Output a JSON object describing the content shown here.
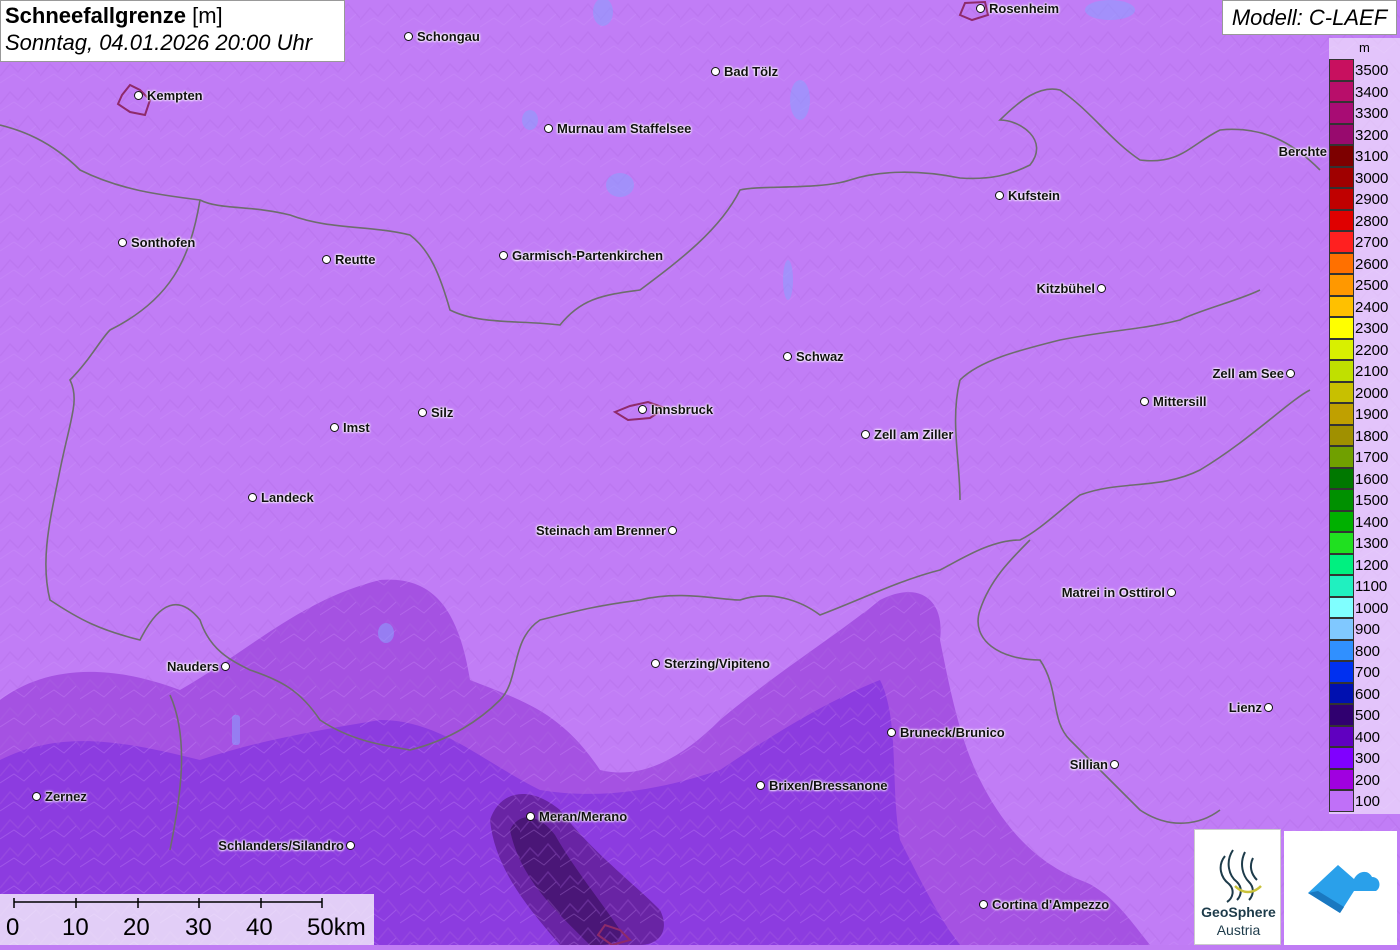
{
  "title": {
    "variable": "Schneefallgrenze",
    "unit": "[m]",
    "datetime": "Sonntag, 04.01.2026 20:00 Uhr"
  },
  "model_label": "Modell: C-LAEF",
  "legend": {
    "unit": "m",
    "levels": [
      {
        "value": "3500",
        "color": "#c8105f"
      },
      {
        "value": "3400",
        "color": "#b80e6a"
      },
      {
        "value": "3300",
        "color": "#a80c74"
      },
      {
        "value": "3200",
        "color": "#980a6e"
      },
      {
        "value": "3100",
        "color": "#7d0000"
      },
      {
        "value": "3000",
        "color": "#a00000"
      },
      {
        "value": "2900",
        "color": "#c00000"
      },
      {
        "value": "2800",
        "color": "#e00000"
      },
      {
        "value": "2700",
        "color": "#ff2020"
      },
      {
        "value": "2600",
        "color": "#ff7000"
      },
      {
        "value": "2500",
        "color": "#ff9800"
      },
      {
        "value": "2400",
        "color": "#ffc000"
      },
      {
        "value": "2300",
        "color": "#ffff00"
      },
      {
        "value": "2200",
        "color": "#d8f000"
      },
      {
        "value": "2100",
        "color": "#c0e000"
      },
      {
        "value": "2000",
        "color": "#c8c000"
      },
      {
        "value": "1900",
        "color": "#c0a000"
      },
      {
        "value": "1800",
        "color": "#a09000"
      },
      {
        "value": "1700",
        "color": "#70a000"
      },
      {
        "value": "1600",
        "color": "#007800"
      },
      {
        "value": "1500",
        "color": "#009000"
      },
      {
        "value": "1400",
        "color": "#00b000"
      },
      {
        "value": "1300",
        "color": "#20e020"
      },
      {
        "value": "1200",
        "color": "#00f080"
      },
      {
        "value": "1100",
        "color": "#20f0c0"
      },
      {
        "value": "1000",
        "color": "#80ffff"
      },
      {
        "value": "900",
        "color": "#80c8ff"
      },
      {
        "value": "800",
        "color": "#3090ff"
      },
      {
        "value": "700",
        "color": "#0030f0"
      },
      {
        "value": "600",
        "color": "#0010b0"
      },
      {
        "value": "500",
        "color": "#300070"
      },
      {
        "value": "400",
        "color": "#6000c0"
      },
      {
        "value": "300",
        "color": "#8000ff"
      },
      {
        "value": "200",
        "color": "#a000e0"
      },
      {
        "value": "100",
        "color": "#c070f8"
      }
    ]
  },
  "cities": [
    {
      "name": "Schongau",
      "label_side": "right"
    },
    {
      "name": "Rosenheim",
      "label_side": "right"
    },
    {
      "name": "Kempten",
      "label_side": "right"
    },
    {
      "name": "Bad Tölz",
      "label_side": "right"
    },
    {
      "name": "Murnau am Staffelsee",
      "label_side": "right"
    },
    {
      "name": "Kufstein",
      "label_side": "right"
    },
    {
      "name": "Sonthofen",
      "label_side": "right"
    },
    {
      "name": "Reutte",
      "label_side": "right"
    },
    {
      "name": "Garmisch-Partenkirchen",
      "label_side": "right"
    },
    {
      "name": "Kitzbühel",
      "label_side": "left"
    },
    {
      "name": "Schwaz",
      "label_side": "right"
    },
    {
      "name": "Zell am See",
      "label_side": "left"
    },
    {
      "name": "Mittersill",
      "label_side": "right"
    },
    {
      "name": "Silz",
      "label_side": "right"
    },
    {
      "name": "Innsbruck",
      "label_side": "right"
    },
    {
      "name": "Imst",
      "label_side": "right"
    },
    {
      "name": "Zell am Ziller",
      "label_side": "right"
    },
    {
      "name": "Landeck",
      "label_side": "right"
    },
    {
      "name": "Steinach am Brenner",
      "label_side": "left"
    },
    {
      "name": "Matrei in Osttirol",
      "label_side": "left"
    },
    {
      "name": "Nauders",
      "label_side": "left"
    },
    {
      "name": "Sterzing/Vipiteno",
      "label_side": "right"
    },
    {
      "name": "Lienz",
      "label_side": "left"
    },
    {
      "name": "Bruneck/Brunico",
      "label_side": "right"
    },
    {
      "name": "Sillian",
      "label_side": "left"
    },
    {
      "name": "Brixen/Bressanone",
      "label_side": "right"
    },
    {
      "name": "Zernez",
      "label_side": "right"
    },
    {
      "name": "Meran/Merano",
      "label_side": "right"
    },
    {
      "name": "Schlanders/Silandro",
      "label_side": "left"
    },
    {
      "name": "Cortina d'Ampezzo",
      "label_side": "right"
    },
    {
      "name": "Berchte",
      "label_side": "left"
    }
  ],
  "scalebar": {
    "ticks": [
      "0",
      "10",
      "20",
      "30",
      "40",
      "50km"
    ]
  },
  "logos": {
    "geosphere_line1": "GeoSphere",
    "geosphere_line2": "Austria"
  }
}
